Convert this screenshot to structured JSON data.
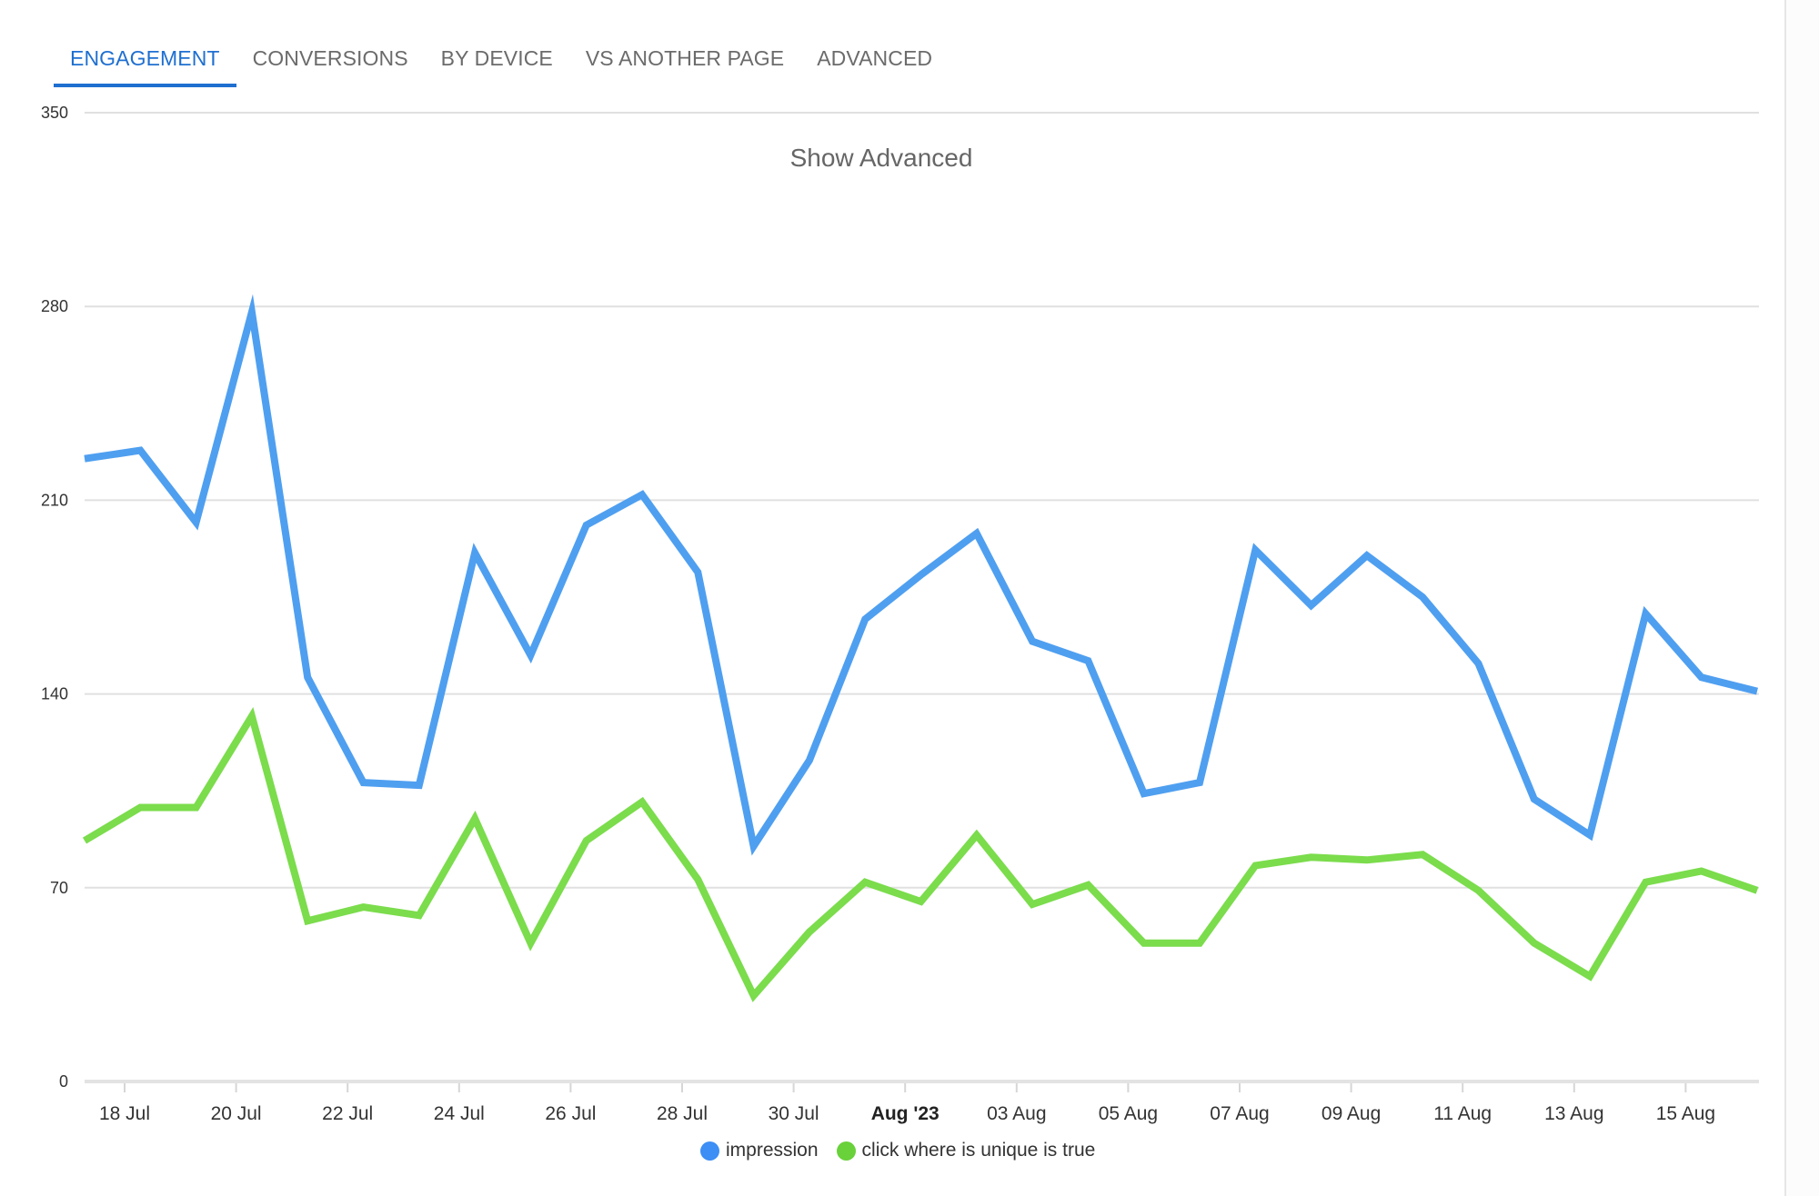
{
  "tabs": [
    {
      "label": "ENGAGEMENT",
      "active": true
    },
    {
      "label": "CONVERSIONS",
      "active": false
    },
    {
      "label": "BY DEVICE",
      "active": false
    },
    {
      "label": "VS ANOTHER PAGE",
      "active": false
    },
    {
      "label": "ADVANCED",
      "active": false
    }
  ],
  "colors": {
    "accent": "#1f6fd0",
    "impression": "#4f9ff0",
    "click": "#7bdc4c",
    "impression_legend": "#3d8ef5",
    "click_legend": "#69d13a",
    "grid": "#e0e0e0",
    "axis": "#e3e3e3"
  },
  "chart_data": {
    "type": "line",
    "title": "Show Advanced",
    "xlabel": "",
    "ylabel": "",
    "ylim": [
      0,
      350
    ],
    "yticks": [
      0,
      70,
      140,
      210,
      280,
      350
    ],
    "grid": true,
    "legend_position": "bottom-center",
    "x": [
      "17 Jul",
      "18 Jul",
      "19 Jul",
      "20 Jul",
      "21 Jul",
      "22 Jul",
      "23 Jul",
      "24 Jul",
      "25 Jul",
      "26 Jul",
      "27 Jul",
      "28 Jul",
      "29 Jul",
      "30 Jul",
      "31 Jul",
      "01 Aug",
      "02 Aug",
      "03 Aug",
      "04 Aug",
      "05 Aug",
      "06 Aug",
      "07 Aug",
      "08 Aug",
      "09 Aug",
      "10 Aug",
      "11 Aug",
      "12 Aug",
      "13 Aug",
      "14 Aug",
      "15 Aug",
      "16 Aug"
    ],
    "xtick_labels": [
      {
        "label": "18 Jul",
        "bold": false
      },
      {
        "label": "20 Jul",
        "bold": false
      },
      {
        "label": "22 Jul",
        "bold": false
      },
      {
        "label": "24 Jul",
        "bold": false
      },
      {
        "label": "26 Jul",
        "bold": false
      },
      {
        "label": "28 Jul",
        "bold": false
      },
      {
        "label": "30 Jul",
        "bold": false
      },
      {
        "label": "Aug '23",
        "bold": true
      },
      {
        "label": "03 Aug",
        "bold": false
      },
      {
        "label": "05 Aug",
        "bold": false
      },
      {
        "label": "07 Aug",
        "bold": false
      },
      {
        "label": "09 Aug",
        "bold": false
      },
      {
        "label": "11 Aug",
        "bold": false
      },
      {
        "label": "13 Aug",
        "bold": false
      },
      {
        "label": "15 Aug",
        "bold": false
      }
    ],
    "series": [
      {
        "name": "impression",
        "values": [
          225,
          228,
          202,
          278,
          146,
          108,
          107,
          191,
          154,
          201,
          212,
          184,
          85,
          116,
          167,
          183,
          198,
          159,
          152,
          104,
          108,
          192,
          172,
          190,
          175,
          151,
          102,
          89,
          169,
          146,
          141
        ]
      },
      {
        "name": "click where is unique is true",
        "values": [
          87,
          99,
          99,
          132,
          58,
          63,
          60,
          95,
          50,
          87,
          101,
          73,
          31,
          54,
          72,
          65,
          89,
          64,
          71,
          50,
          50,
          78,
          81,
          80,
          82,
          69,
          50,
          38,
          72,
          76,
          69
        ]
      }
    ]
  }
}
